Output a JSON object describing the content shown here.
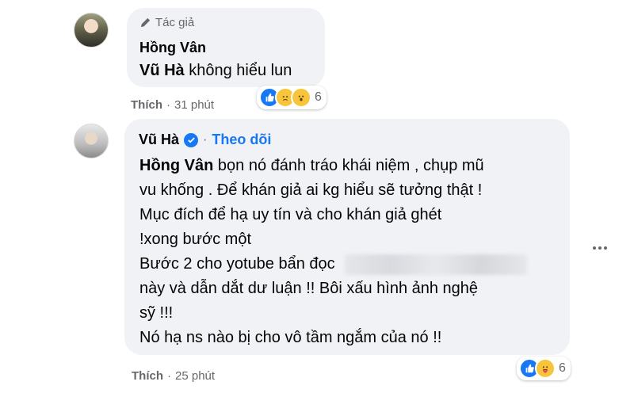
{
  "comment_1": {
    "author_tag": "Tác giả",
    "name": "Hồng Vân",
    "mention": "Vũ Hà",
    "text": " không hiểu lun",
    "like_label": "Thích",
    "time": "31 phút",
    "reaction_count": "6",
    "reactions": [
      "like-icon",
      "sad-icon",
      "wow-icon"
    ]
  },
  "comment_2": {
    "name": "Vũ Hà",
    "follow_label": "Theo dõi",
    "separator": "·",
    "mention": "Hồng Vân",
    "lines": [
      " bọn nó đánh tráo khái niệm , chụp mũ",
      "vu khống . Để khán giả ai kg hiểu sẽ tưởng thật !",
      "Mục đích để hạ uy tín và cho khán giả ghét",
      "!xong bước một",
      "Bước 2 cho yotube bẩn đọc",
      "này và dẫn dắt dư luận !! Bôi xấu hình ảnh nghệ",
      "sỹ !!!",
      "Nó hạ ns nào bị cho vô tầm ngắm của nó !!"
    ],
    "like_label": "Thích",
    "time": "25 phút",
    "reaction_count": "6",
    "reactions": [
      "like-icon",
      "care-icon"
    ]
  },
  "meta_separator": "·",
  "colors": {
    "link": "#1877f2",
    "bubble": "#f0f2f5",
    "muted": "#65676b"
  }
}
